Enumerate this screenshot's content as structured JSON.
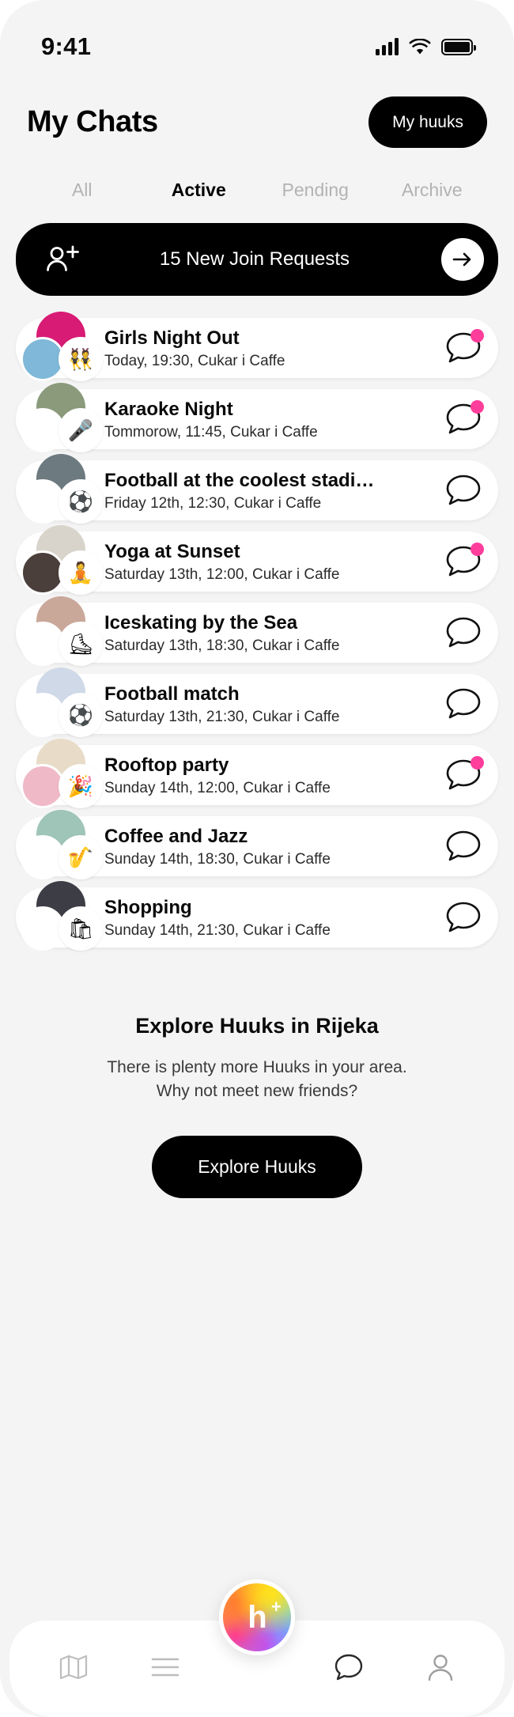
{
  "status_bar": {
    "time": "9:41",
    "signal_icon": "signal-bars-icon",
    "wifi_icon": "wifi-icon",
    "battery_icon": "battery-full-icon"
  },
  "header": {
    "title": "My Chats",
    "my_huuks_label": "My huuks"
  },
  "tabs": [
    {
      "label": "All",
      "active": false
    },
    {
      "label": "Active",
      "active": true
    },
    {
      "label": "Pending",
      "active": false
    },
    {
      "label": "Archive",
      "active": false
    }
  ],
  "join_banner": {
    "label": "15 New Join Requests",
    "count": 15,
    "icon": "users-plus-icon",
    "arrow_icon": "arrow-right-icon",
    "background_color": "#000000"
  },
  "chats": [
    {
      "title": "Girls Night Out",
      "subtitle": "Today, 19:30, Cukar i Caffe",
      "emoji": "👯",
      "unread": true,
      "avatar_main": "#d81b74",
      "avatar_secondary": "#7fb8d8"
    },
    {
      "title": "Karaoke Night",
      "subtitle": "Tommorow, 11:45, Cukar i Caffe",
      "emoji": "🎤",
      "unread": true,
      "avatar_main": "#8a9a7b",
      "avatar_secondary": "#ffffff"
    },
    {
      "title": "Football at the coolest stadi…",
      "subtitle": "Friday 12th, 12:30, Cukar i Caffe",
      "emoji": "⚽",
      "unread": false,
      "avatar_main": "#6d7a80",
      "avatar_secondary": "#ffffff"
    },
    {
      "title": "Yoga at Sunset",
      "subtitle": "Saturday 13th, 12:00, Cukar i Caffe",
      "emoji": "🧘",
      "unread": true,
      "avatar_main": "#d9d4cb",
      "avatar_secondary": "#4a3f3a"
    },
    {
      "title": "Iceskating by the Sea",
      "subtitle": "Saturday 13th, 18:30, Cukar i Caffe",
      "emoji": "⛸",
      "unread": false,
      "avatar_main": "#c9a89a",
      "avatar_secondary": "#ffffff"
    },
    {
      "title": "Football match",
      "subtitle": "Saturday 13th, 21:30, Cukar i Caffe",
      "emoji": "⚽",
      "unread": false,
      "avatar_main": "#cfd9e8",
      "avatar_secondary": "#ffffff"
    },
    {
      "title": "Rooftop party",
      "subtitle": "Sunday 14th, 12:00, Cukar i Caffe",
      "emoji": "🎉",
      "unread": true,
      "avatar_main": "#e8dcc8",
      "avatar_secondary": "#f0b9c8"
    },
    {
      "title": "Coffee and Jazz",
      "subtitle": "Sunday 14th, 18:30, Cukar i Caffe",
      "emoji": "🎷",
      "unread": false,
      "avatar_main": "#9fc4b8",
      "avatar_secondary": "#ffffff"
    },
    {
      "title": "Shopping",
      "subtitle": "Sunday 14th, 21:30, Cukar i Caffe",
      "emoji": "🛍",
      "unread": false,
      "avatar_main": "#3d3d45",
      "avatar_secondary": "#ffffff"
    }
  ],
  "explore": {
    "title": "Explore Huuks in Rijeka",
    "subtitle_line1": "There is plenty more Huuks in your area.",
    "subtitle_line2": "Why not meet new friends?",
    "button_label": "Explore Huuks"
  },
  "bottom_nav": {
    "items": [
      {
        "icon": "map-icon"
      },
      {
        "icon": "list-menu-icon"
      },
      {
        "icon": "chat-bubble-icon"
      },
      {
        "icon": "person-icon"
      }
    ],
    "fab": {
      "label": "h",
      "superscript": "+",
      "icon": "huuk-plus-icon"
    }
  },
  "colors": {
    "accent_pink": "#ff3d9a",
    "background": "#f4f4f4",
    "card": "#ffffff",
    "black": "#000000"
  }
}
